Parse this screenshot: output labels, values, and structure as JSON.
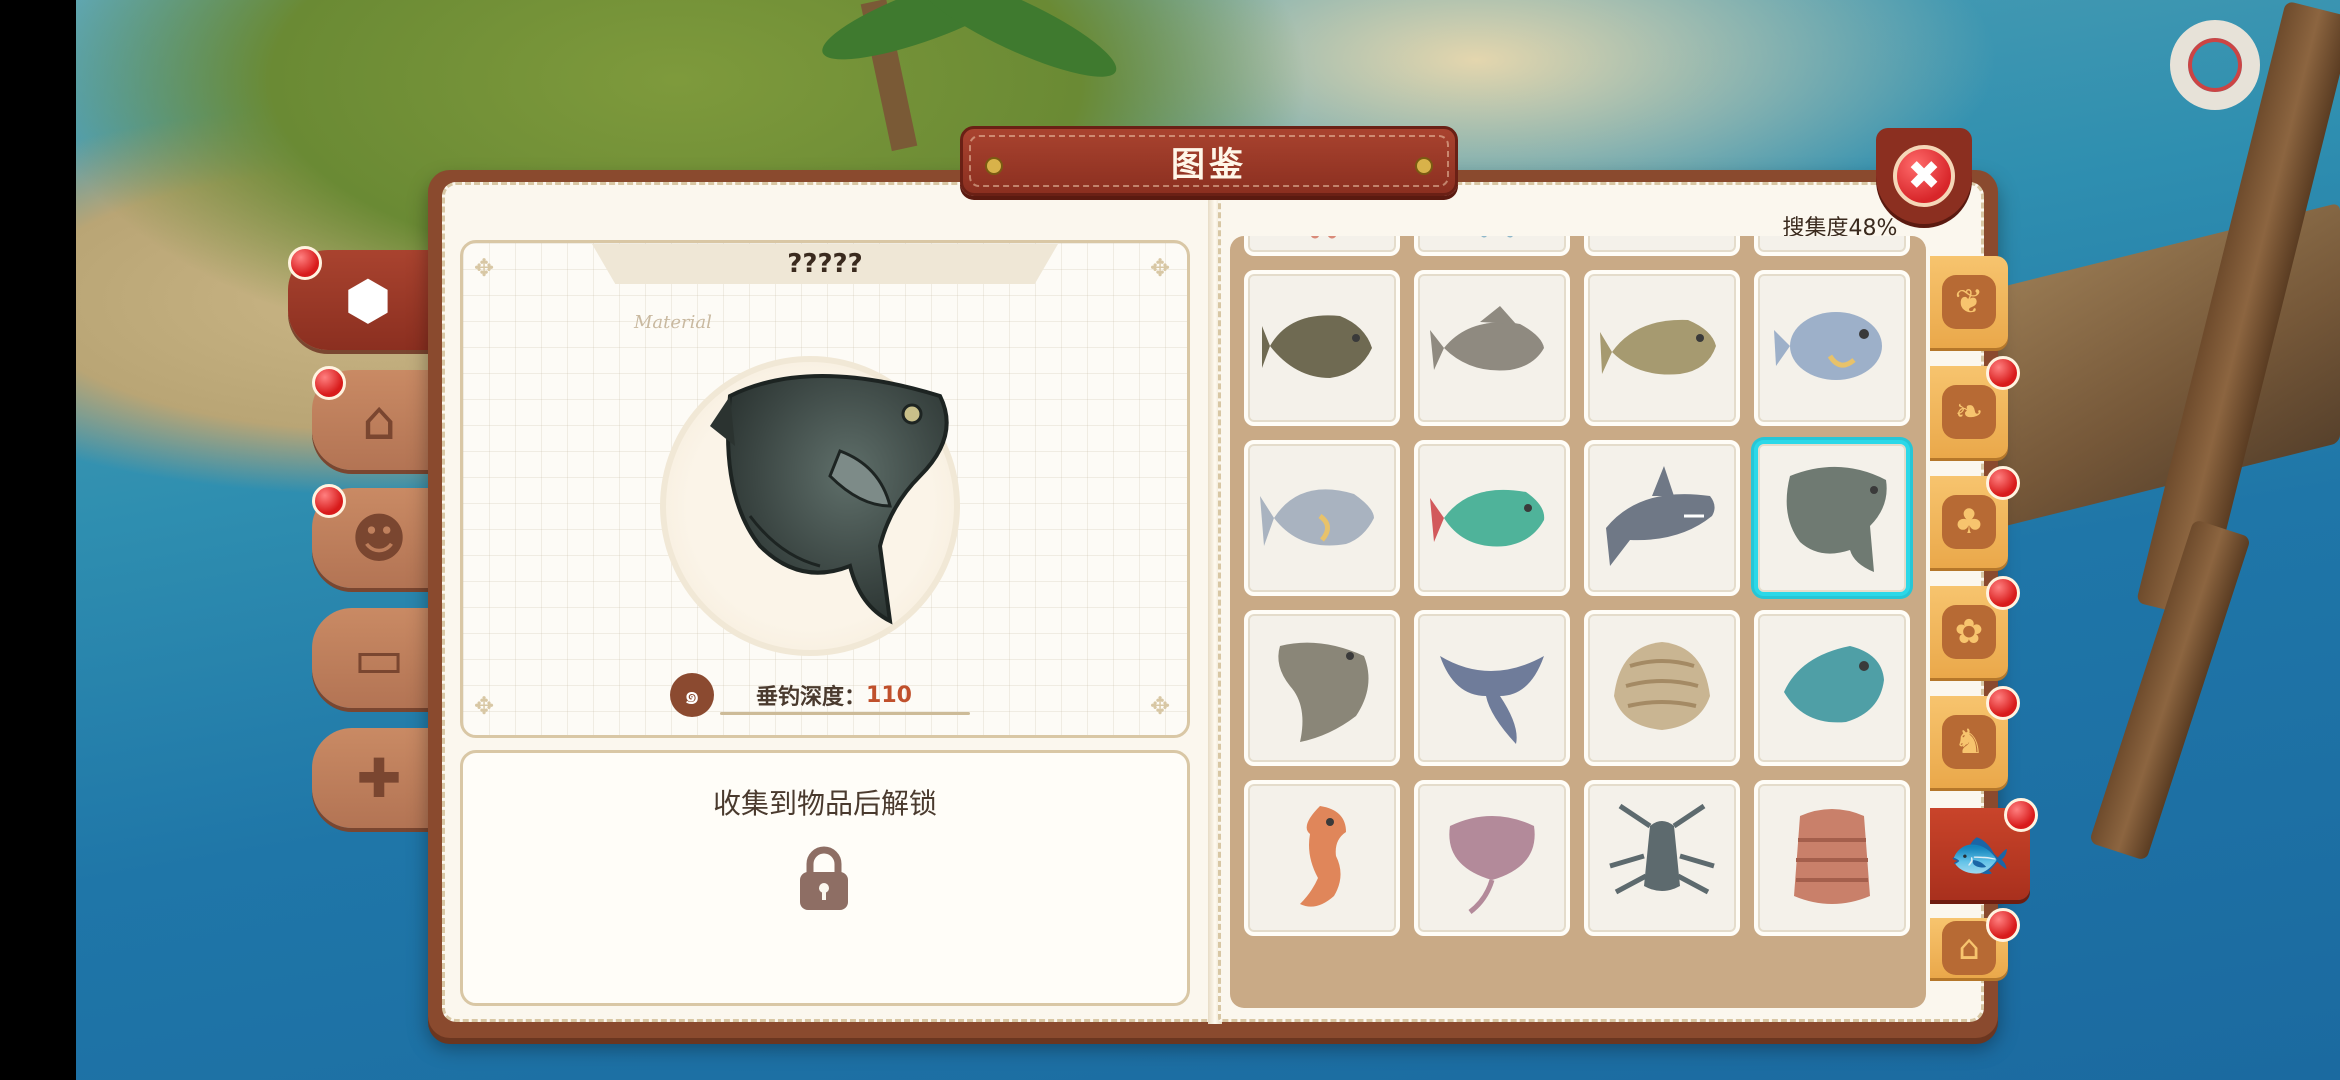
{
  "header": {
    "title": "图鉴",
    "close_symbol": "✖"
  },
  "collection": {
    "progress_text": "搜集度48%",
    "progress_percent": 48
  },
  "detail": {
    "name": "?????",
    "handwriting": "Material",
    "depth_label": "垂钓深度：",
    "depth_value": "110",
    "lock_message": "收集到物品后解锁"
  },
  "left_tabs": [
    {
      "icon": "cube-icon",
      "glyph": "⬢",
      "active": true,
      "badge": true
    },
    {
      "icon": "house-icon",
      "glyph": "⌂",
      "active": false,
      "badge": true
    },
    {
      "icon": "owl-icon",
      "glyph": "☻",
      "active": false,
      "badge": true
    },
    {
      "icon": "sofa-icon",
      "glyph": "▭",
      "active": false,
      "badge": false
    },
    {
      "icon": "shirt-icon",
      "glyph": "✚",
      "active": false,
      "badge": false
    }
  ],
  "right_tabs": [
    {
      "icon": "grain-icon",
      "glyph": "❦",
      "active": false,
      "badge": false
    },
    {
      "icon": "wheat-icon",
      "glyph": "❧",
      "active": false,
      "badge": true
    },
    {
      "icon": "trees-icon",
      "glyph": "♣",
      "active": false,
      "badge": true
    },
    {
      "icon": "flower-icon",
      "glyph": "✿",
      "active": false,
      "badge": true
    },
    {
      "icon": "chicken-icon",
      "glyph": "♞",
      "active": false,
      "badge": true
    },
    {
      "icon": "fish-icon",
      "glyph": "🐟",
      "active": true,
      "badge": true
    },
    {
      "icon": "stall-icon",
      "glyph": "⌂",
      "active": false,
      "badge": true
    }
  ],
  "grid": {
    "items": [
      {
        "kind": "octopus",
        "color": "#d98a78"
      },
      {
        "kind": "squid",
        "color": "#8fb7c9"
      },
      {
        "kind": "shark-small",
        "color": "#9aa6b2"
      },
      {
        "kind": "swordfish",
        "color": "#8f9fae"
      },
      {
        "kind": "grouper",
        "color": "#6f6a52"
      },
      {
        "kind": "snapper",
        "color": "#8f8a80"
      },
      {
        "kind": "carp",
        "color": "#a69a70"
      },
      {
        "kind": "pufferfish",
        "color": "#9db0c9"
      },
      {
        "kind": "trevally",
        "color": "#a9b3c0"
      },
      {
        "kind": "parrotfish",
        "color": "#4fb39a"
      },
      {
        "kind": "great-white-shark",
        "color": "#6f7886"
      },
      {
        "kind": "sunfish",
        "color": "#6f7a72",
        "selected": true
      },
      {
        "kind": "coelacanth",
        "color": "#8a8678"
      },
      {
        "kind": "manta-ray",
        "color": "#6f7c9a"
      },
      {
        "kind": "giant-clam",
        "color": "#c9b592"
      },
      {
        "kind": "napoleon-wrasse",
        "color": "#4f9fa6"
      },
      {
        "kind": "seahorse",
        "color": "#e0865a"
      },
      {
        "kind": "stingray",
        "color": "#b38a9a"
      },
      {
        "kind": "lobster",
        "color": "#5d6a6e"
      },
      {
        "kind": "slipper-lobster",
        "color": "#c9806a"
      }
    ]
  },
  "colors": {
    "accent": "#8b2f20",
    "selection": "#2bd8e8",
    "depth_value": "#c0502c"
  }
}
